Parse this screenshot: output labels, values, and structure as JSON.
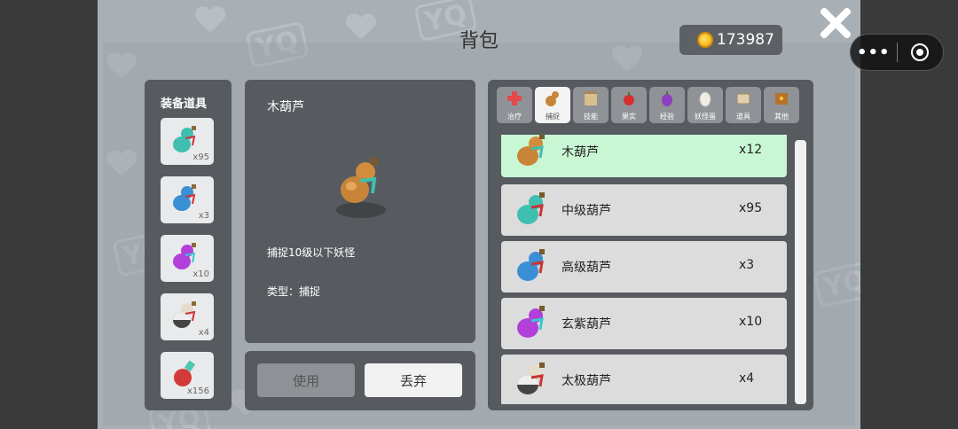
{
  "title": "背包",
  "coins": "173987",
  "equipment": {
    "title": "装备道具",
    "slots": [
      {
        "icon": "mid-gourd-icon",
        "count": "x95",
        "color": "#3fbfb0"
      },
      {
        "icon": "high-gourd-icon",
        "count": "x3",
        "color": "#3b8fd4"
      },
      {
        "icon": "purple-gourd-icon",
        "count": "x10",
        "color": "#b23fd9"
      },
      {
        "icon": "taiji-gourd-icon",
        "count": "x4",
        "color": "#6b6b6b"
      },
      {
        "icon": "red-potion-icon",
        "count": "x156",
        "color": "#d33a3a"
      }
    ]
  },
  "detail": {
    "name": "木葫芦",
    "description": "捕捉10级以下妖怪",
    "type": "类型：捕捉"
  },
  "actions": {
    "use": "使用",
    "drop": "丢弃"
  },
  "tabs": [
    {
      "label": "治疗",
      "icon": "red-cross-icon",
      "active": false
    },
    {
      "label": "捕捉",
      "icon": "gourd-icon",
      "active": true
    },
    {
      "label": "技能",
      "icon": "scroll-icon",
      "active": false
    },
    {
      "label": "果实",
      "icon": "apple-icon",
      "active": false
    },
    {
      "label": "经验",
      "icon": "grape-icon",
      "active": false
    },
    {
      "label": "妖怪蛋",
      "icon": "egg-icon",
      "active": false
    },
    {
      "label": "道具",
      "icon": "bag-icon",
      "active": false
    },
    {
      "label": "其他",
      "icon": "chest-icon",
      "active": false
    }
  ],
  "items": [
    {
      "name": "木葫芦",
      "count": "x12",
      "color": "#c8853a",
      "selected": true
    },
    {
      "name": "中级葫芦",
      "count": "x95",
      "color": "#3fbfb0",
      "selected": false
    },
    {
      "name": "高级葫芦",
      "count": "x3",
      "color": "#3b8fd4",
      "selected": false
    },
    {
      "name": "玄紫葫芦",
      "count": "x10",
      "color": "#b23fd9",
      "selected": false
    },
    {
      "name": "太极葫芦",
      "count": "x4",
      "color": "#6b6b6b",
      "selected": false
    }
  ],
  "miniprogram": {
    "more": "•••"
  }
}
